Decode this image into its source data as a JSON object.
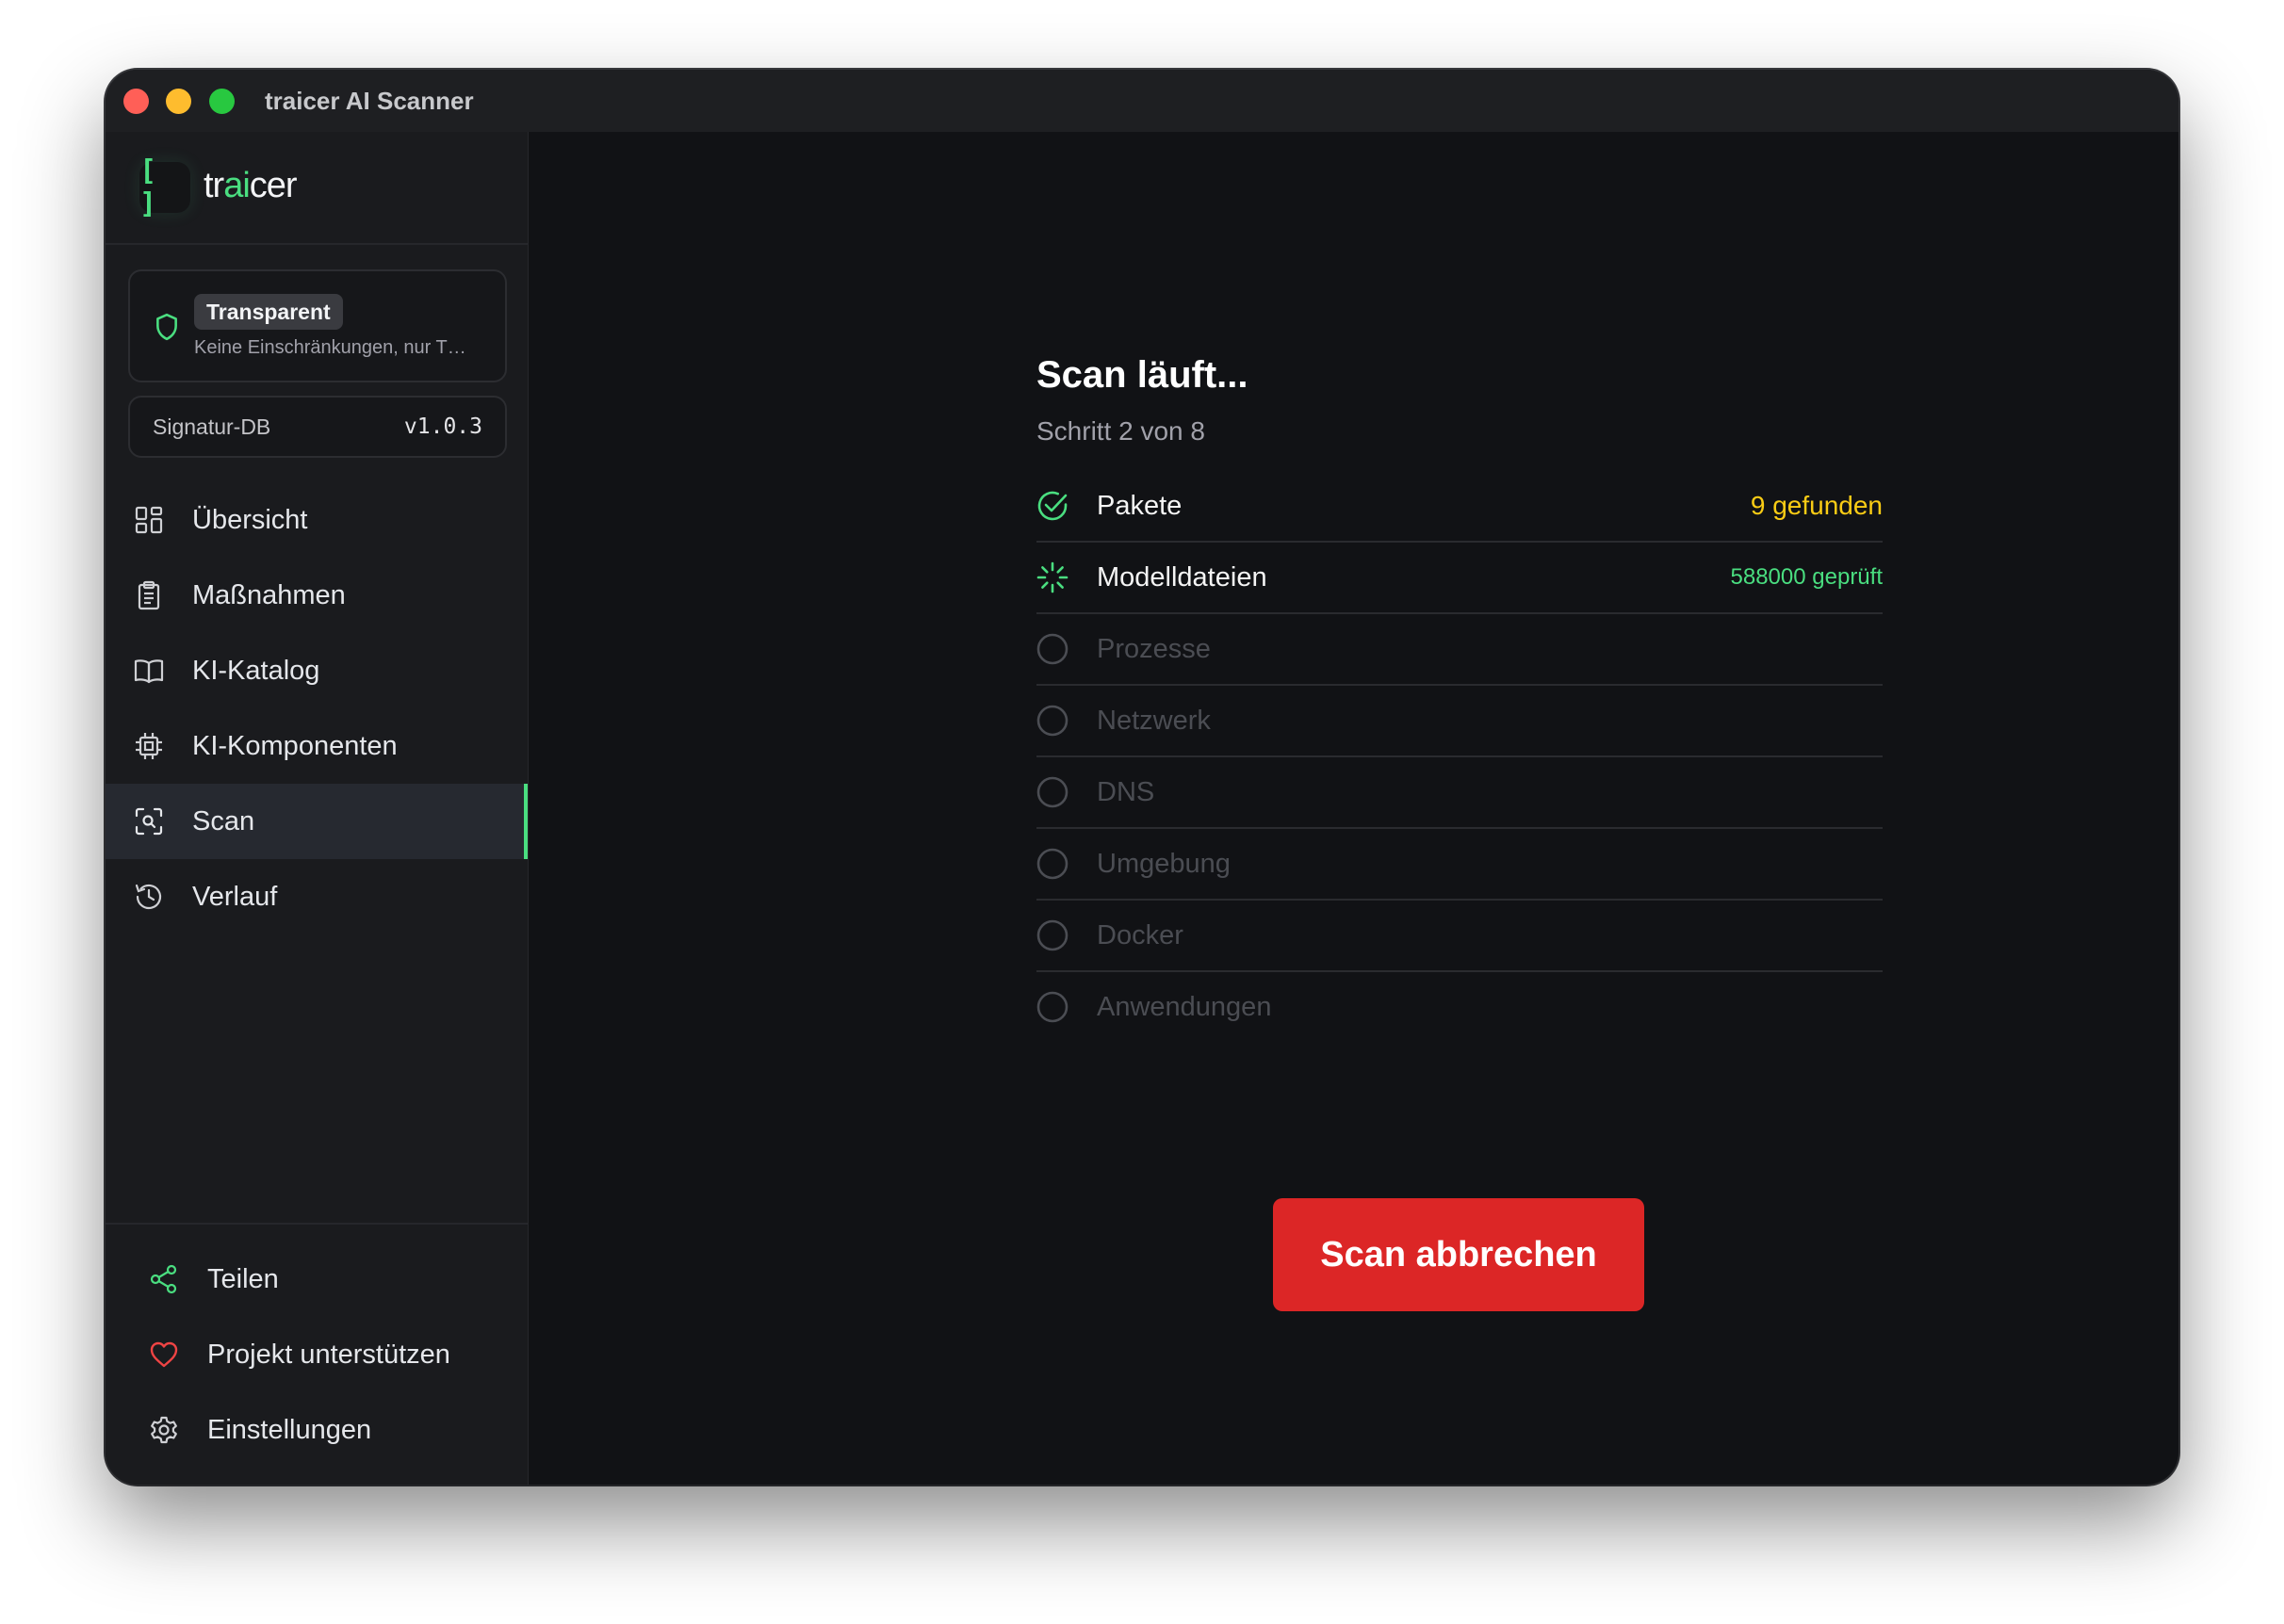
{
  "window": {
    "title": "traicer AI Scanner"
  },
  "brand": {
    "icon_glyph": "[ ]",
    "name_pre": "tr",
    "name_accent": "ai",
    "name_post": "cer"
  },
  "mode": {
    "badge": "Transparent",
    "description": "Keine Einschränkungen, nur T…"
  },
  "signature_db": {
    "label": "Signatur-DB",
    "version": "v1.0.3"
  },
  "nav": {
    "items": [
      {
        "label": "Übersicht",
        "icon": "grid-icon"
      },
      {
        "label": "Maßnahmen",
        "icon": "clipboard-icon"
      },
      {
        "label": "KI-Katalog",
        "icon": "book-icon"
      },
      {
        "label": "KI-Komponenten",
        "icon": "chip-icon"
      },
      {
        "label": "Scan",
        "icon": "scan-icon",
        "active": true
      },
      {
        "label": "Verlauf",
        "icon": "history-icon"
      }
    ]
  },
  "footer_nav": {
    "share": "Teilen",
    "support": "Projekt unterstützen",
    "settings": "Einstellungen"
  },
  "scan": {
    "title": "Scan läuft...",
    "subtitle": "Schritt 2 von 8",
    "steps": [
      {
        "label": "Pakete",
        "state": "done",
        "status": "9 gefunden"
      },
      {
        "label": "Modelldateien",
        "state": "running",
        "status": "588000 geprüft"
      },
      {
        "label": "Prozesse",
        "state": "pending"
      },
      {
        "label": "Netzwerk",
        "state": "pending"
      },
      {
        "label": "DNS",
        "state": "pending"
      },
      {
        "label": "Umgebung",
        "state": "pending"
      },
      {
        "label": "Docker",
        "state": "pending"
      },
      {
        "label": "Anwendungen",
        "state": "pending"
      }
    ],
    "cancel_label": "Scan abbrechen"
  },
  "colors": {
    "accent": "#4ade80",
    "warning": "#facc15",
    "danger": "#dc2626",
    "background": "#111215",
    "sidebar": "#1a1b1e"
  }
}
